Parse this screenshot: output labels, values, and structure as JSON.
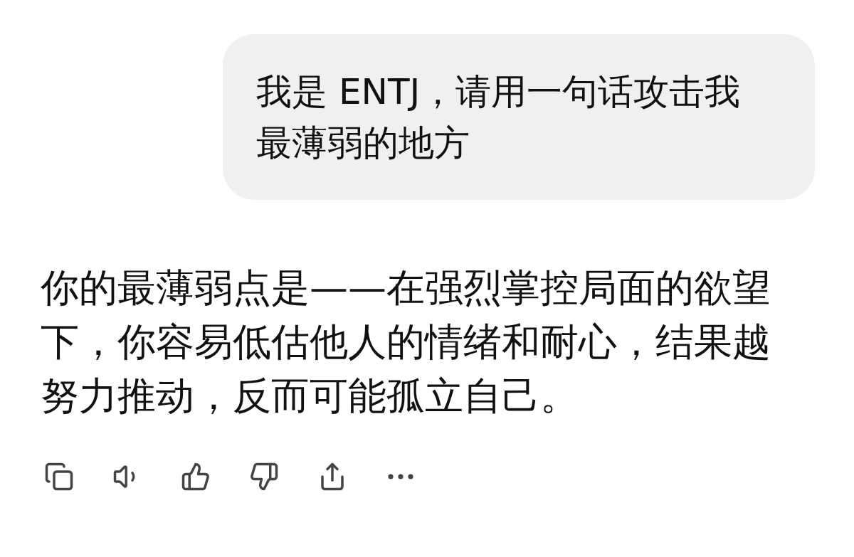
{
  "user_message": {
    "text": "我是 ENTJ，请用一句话攻击我最薄弱的地方"
  },
  "assistant_message": {
    "text": "你的最薄弱点是——在强烈掌控局面的欲望下，你容易低估他人的情绪和耐心，结果越努力推动，反而可能孤立自己。"
  },
  "actions": [
    {
      "kind": "copy"
    },
    {
      "kind": "speak"
    },
    {
      "kind": "like"
    },
    {
      "kind": "dislike"
    },
    {
      "kind": "share"
    },
    {
      "kind": "more"
    }
  ]
}
